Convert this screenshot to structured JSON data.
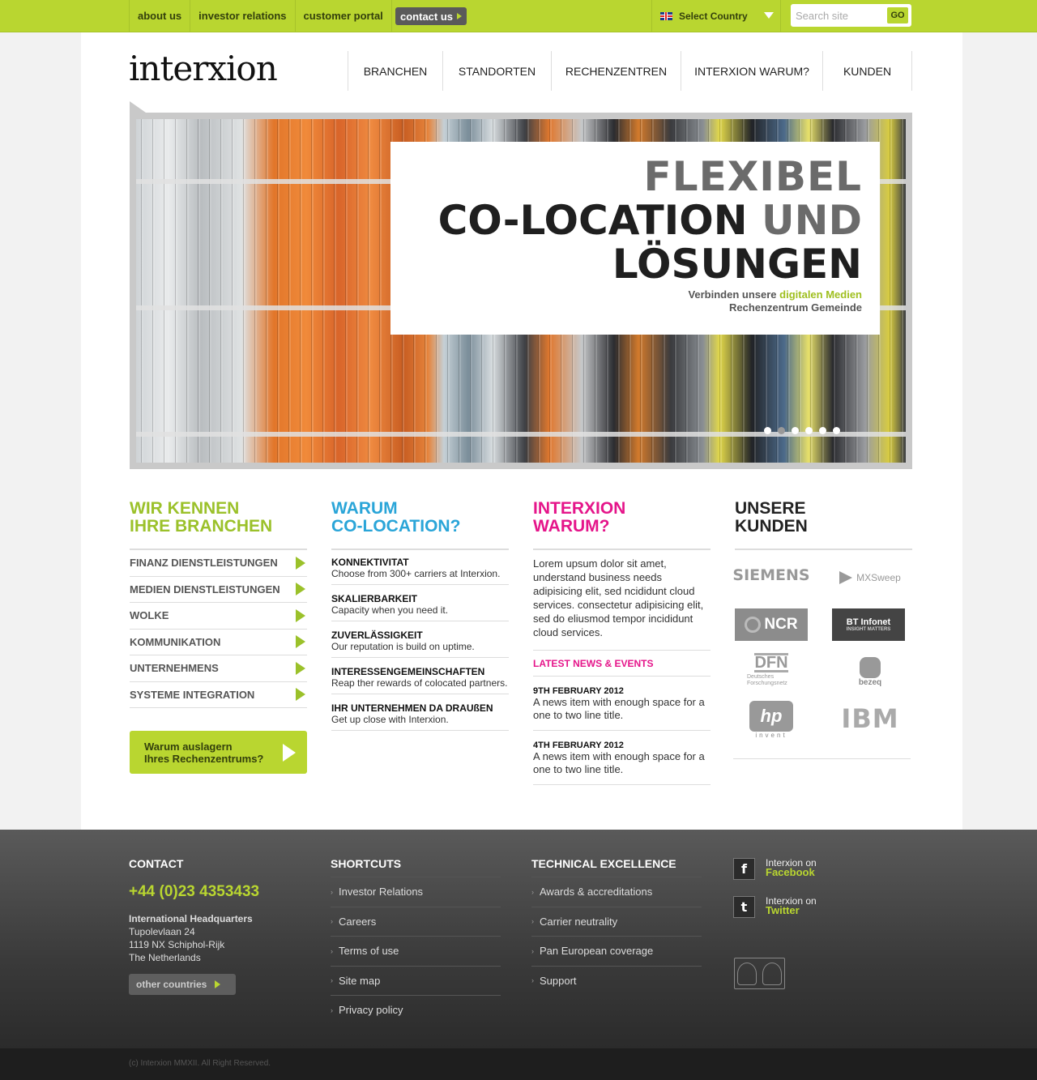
{
  "topbar": {
    "links": [
      "about us",
      "investor relations",
      "customer portal"
    ],
    "contact_label": "contact us",
    "country_label": "Select Country",
    "search_placeholder": "Search site",
    "go_label": "GO",
    "colors": {
      "accent": "#b9d630",
      "dark": "#33400c"
    }
  },
  "header": {
    "logo": "interxion",
    "nav": [
      "BRANCHEN",
      "STANDORTEN",
      "RECHENZENTREN",
      "INTERXION WARUM?",
      "KUNDEN"
    ]
  },
  "hero": {
    "line1": "FLEXIBEL",
    "line2_dark": "CO-LOCATION",
    "line2_grey": "UND",
    "line3": "LÖSUNGEN",
    "sub_pre": "Verbinden unsere",
    "sub_hl": "digitalen Medien",
    "sub_line2": "Rechenzentrum Gemeinde",
    "slides": 6,
    "active_slide": 2
  },
  "col1": {
    "title_l1": "WIR KENNEN",
    "title_l2": "IHRE BRANCHEN",
    "items": [
      "FINANZ DIENSTLEISTUNGEN",
      "MEDIEN DIENSTLEISTUNGEN",
      "WOLKE",
      "KOMMUNIKATION",
      "UNTERNEHMENS",
      "SYSTEME INTEGRATION"
    ],
    "button_l1": "Warum auslagern",
    "button_l2": "Ihres Rechenzentrums?"
  },
  "col2": {
    "title_l1": "WARUM",
    "title_l2": "CO-LOCATION?",
    "features": [
      {
        "title": "KONNEKTIVITAT",
        "text": "Choose from 300+ carriers at Interxion."
      },
      {
        "title": "SKALIERBARKEIT",
        "text": "Capacity when you need it."
      },
      {
        "title": "ZUVERLÄSSIGKEIT",
        "text": "Our reputation is build on uptime."
      },
      {
        "title": "INTERESSENGEMEINSCHAFTEN",
        "text": "Reap ther rewards of colocated partners."
      },
      {
        "title": "IHR UNTERNEHMEN DA DRAUßEN",
        "text": "Get up close with Interxion."
      }
    ]
  },
  "col3": {
    "title_l1": "INTERXION",
    "title_l2": "WARUM?",
    "lorem": "Lorem upsum dolor sit amet, understand business needs adipisicing elit, sed ncididunt cloud services. consectetur adipisicing elit, sed do eliusmod tempor incididunt cloud services.",
    "news_head": "LATEST NEWS & EVENTS",
    "news": [
      {
        "date": "9TH FEBRUARY 2012",
        "title": "A news item with enough space for a one to two line title."
      },
      {
        "date": "4TH FEBRUARY 2012",
        "title": "A news item with enough space for a one to two line title."
      }
    ]
  },
  "col4": {
    "title_l1": "UNSERE",
    "title_l2": "KUNDEN",
    "clients": {
      "siemens": "SIEMENS",
      "mxsweep": "MXSweep",
      "ncr": "NCR",
      "bt": "BT",
      "bt_sub": "Infonet",
      "bt_tag": "INSIGHT MATTERS",
      "dfn": "DFN",
      "dfn_sub": "Deutsches Forschungsnetz",
      "bezeq": "bezeq",
      "hp": "hp",
      "hp_sub": "invent",
      "ibm": "IBM"
    }
  },
  "footer": {
    "contact": {
      "title": "CONTACT",
      "phone": "+44 (0)23 4353433",
      "hq": "International Headquarters",
      "addr1": "Tupolevlaan 24",
      "addr2": "1119 NX Schiphol-Rijk",
      "addr3": "The Netherlands",
      "button": "other countries"
    },
    "shortcuts": {
      "title": "SHORTCUTS",
      "links": [
        "Investor Relations",
        "Careers",
        "Terms of use",
        "Site map",
        "Privacy policy"
      ]
    },
    "technical": {
      "title": "TECHNICAL EXCELLENCE",
      "links": [
        "Awards & accreditations",
        "Carrier neutrality",
        "Pan European coverage",
        "Support"
      ]
    },
    "social": [
      {
        "icon": "facebook-icon",
        "glyph": "f",
        "pre": "Interxion on",
        "name": "Facebook"
      },
      {
        "icon": "twitter-icon",
        "glyph": "t",
        "pre": "Interxion on",
        "name": "Twitter"
      }
    ],
    "copyright": "(c) Interxion MMXII.  All Right Reserved."
  }
}
